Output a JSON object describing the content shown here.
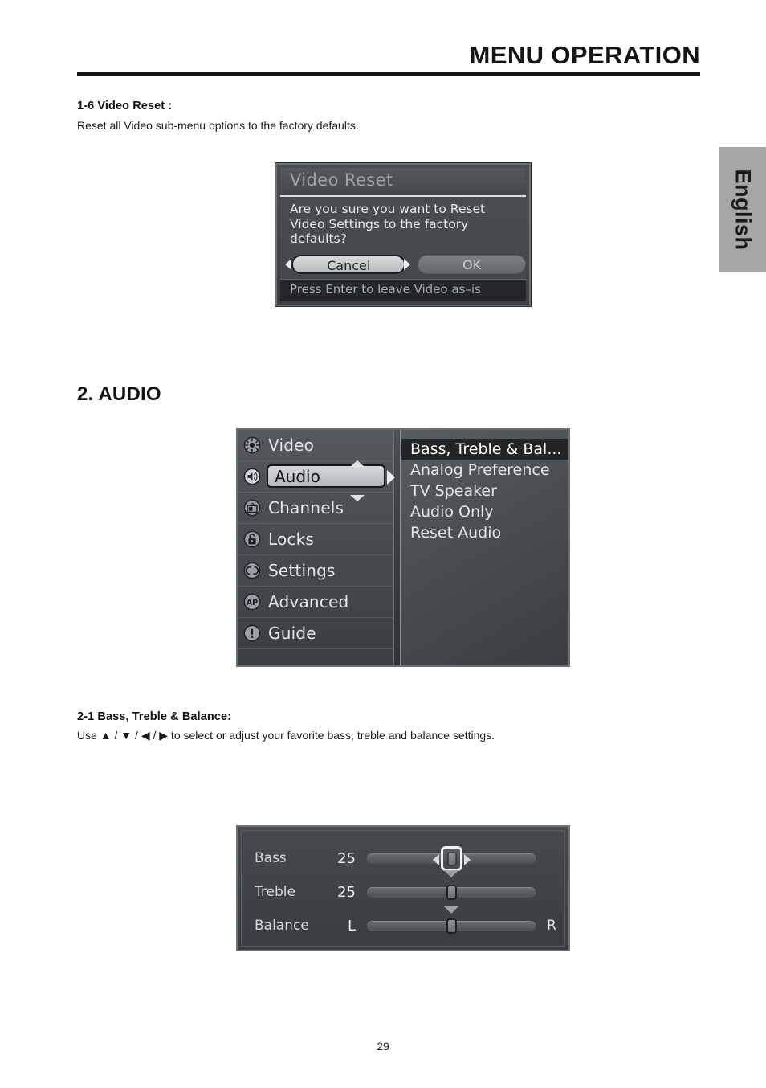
{
  "page": {
    "header_title": "MENU OPERATION",
    "language_tab": "English",
    "page_number": "29"
  },
  "sections": {
    "video_reset": {
      "heading": "1-6  Video Reset :",
      "body": "Reset all Video sub-menu options to the factory defaults."
    },
    "audio": {
      "heading": "2. AUDIO"
    },
    "bass_treble_balance": {
      "heading": "2-1  Bass, Treble & Balance:",
      "body": "Use ▲ / ▼ / ◀ / ▶ to select or adjust your favorite bass, treble and balance settings."
    }
  },
  "video_reset_dialog": {
    "title": "Video Reset",
    "message": "Are you sure you want to Reset Video Settings to the factory defaults?",
    "buttons": [
      {
        "label": "Cancel",
        "selected": true
      },
      {
        "label": "OK",
        "selected": false
      }
    ],
    "footer_hint": "Press Enter to leave Video as–is"
  },
  "audio_menu": {
    "left_items": [
      {
        "label": "Video",
        "icon": "sunburst-icon",
        "active": false
      },
      {
        "label": "Audio",
        "icon": "speaker-icon",
        "active": true
      },
      {
        "label": "Channels",
        "icon": "tv-icon",
        "active": false
      },
      {
        "label": "Locks",
        "icon": "lock-icon",
        "active": false
      },
      {
        "label": "Settings",
        "icon": "refresh-icon",
        "active": false
      },
      {
        "label": "Advanced",
        "icon": "ap-icon",
        "active": false
      },
      {
        "label": "Guide",
        "icon": "exclamation-icon",
        "active": false
      }
    ],
    "right_items": [
      {
        "label": "Bass, Treble & Bal...",
        "highlight": true
      },
      {
        "label": "Analog Preference",
        "highlight": false
      },
      {
        "label": "TV Speaker",
        "highlight": false
      },
      {
        "label": "Audio Only",
        "highlight": false
      },
      {
        "label": "Reset Audio",
        "highlight": false
      }
    ]
  },
  "bass_panel": {
    "rows": [
      {
        "label": "Bass",
        "value": "25",
        "selected": true,
        "pos_pct": 50,
        "left_tag": "",
        "right_tag": ""
      },
      {
        "label": "Treble",
        "value": "25",
        "selected": false,
        "pos_pct": 50,
        "left_tag": "",
        "right_tag": ""
      },
      {
        "label": "Balance",
        "value": "L",
        "selected": false,
        "pos_pct": 50,
        "left_tag": "L",
        "right_tag": "R"
      }
    ]
  },
  "colors": {
    "page_bg": "#ffffff",
    "ink": "#141414",
    "lang_tab_bg": "#a6a6a6",
    "osd_panel": "#44474a",
    "osd_text": "#e4e6e8",
    "osd_highlight_bg": "#222426",
    "osd_pill_bg": "#c9cccd"
  }
}
